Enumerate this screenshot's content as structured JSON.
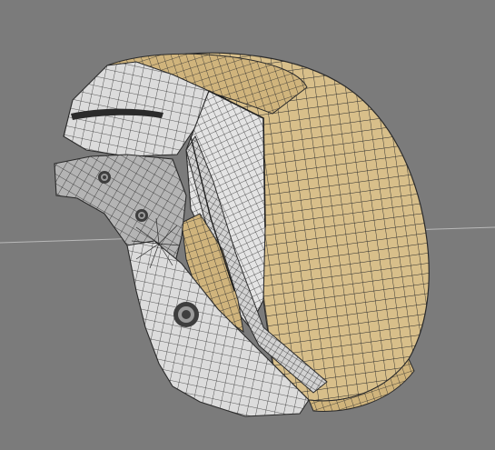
{
  "viewport": {
    "background": "#7b7b7b",
    "horizon_color": "#b9b9b9"
  },
  "model": {
    "kind": "3d-wireframe-helmet",
    "colors": {
      "shell_tan": "#d8bf8a",
      "shell_tan_dark": "#c3a36b",
      "panel_gray": "#dcdcdc",
      "panel_gray_dark": "#a9a9a9",
      "wire": "#2a2a2a",
      "bolt": "#3e3e3e"
    }
  }
}
